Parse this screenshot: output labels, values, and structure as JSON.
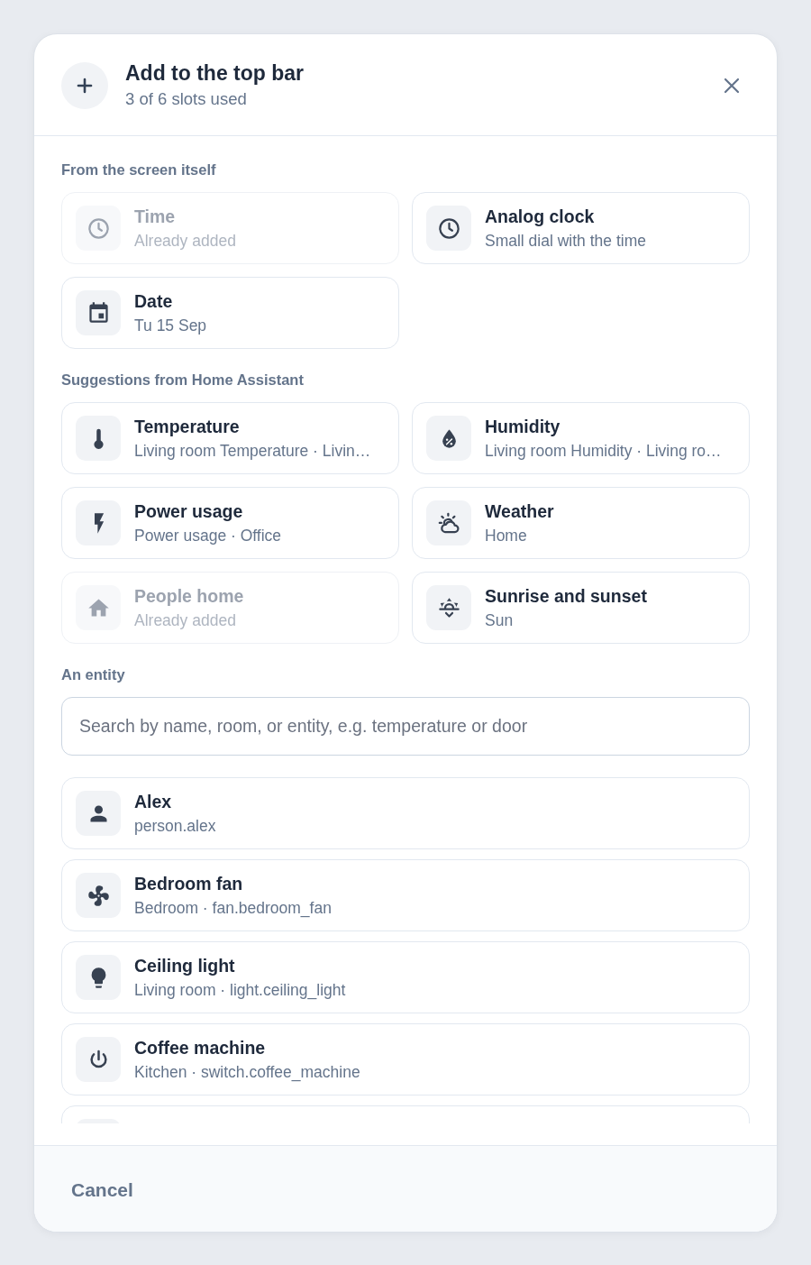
{
  "dialog": {
    "title": "Add to the top bar",
    "subtitle": "3 of 6 slots used"
  },
  "sections": [
    {
      "heading": "From the screen itself",
      "items": [
        {
          "kind": "time",
          "title": "Time",
          "subtitle": "Already added",
          "disabled": true
        },
        {
          "kind": "clock",
          "title": "Analog clock",
          "subtitle": "Small dial with the time",
          "disabled": false
        },
        {
          "kind": "date",
          "title": "Date",
          "subtitle": "Tu 15 Sep",
          "disabled": false
        }
      ]
    },
    {
      "heading": "Suggestions from Home Assistant",
      "items": [
        {
          "kind": "temperature",
          "title": "Temperature",
          "subtitle": "Living room Temperature · Livin…",
          "disabled": false
        },
        {
          "kind": "humidity",
          "title": "Humidity",
          "subtitle": "Living room Humidity · Living ro…",
          "disabled": false
        },
        {
          "kind": "power",
          "title": "Power usage",
          "subtitle": "Power usage · Office",
          "disabled": false
        },
        {
          "kind": "weather",
          "title": "Weather",
          "subtitle": "Home",
          "disabled": false
        },
        {
          "kind": "people",
          "title": "People home",
          "subtitle": "Already added",
          "disabled": true
        },
        {
          "kind": "sun",
          "title": "Sunrise and sunset",
          "subtitle": "Sun",
          "disabled": false
        }
      ]
    }
  ],
  "entity_section": {
    "heading": "An entity",
    "search": {
      "placeholder": "Search by name, room, or entity, e.g. temperature or door"
    },
    "entities": [
      {
        "kind": "person",
        "title": "Alex",
        "subtitle": "person.alex"
      },
      {
        "kind": "fan",
        "title": "Bedroom fan",
        "subtitle": "Bedroom · fan.bedroom_fan"
      },
      {
        "kind": "light",
        "title": "Ceiling light",
        "subtitle": "Living room · light.ceiling_light"
      },
      {
        "kind": "switch",
        "title": "Coffee machine",
        "subtitle": "Kitchen · switch.coffee_machine"
      }
    ]
  },
  "footer": {
    "cancel": "Cancel"
  }
}
